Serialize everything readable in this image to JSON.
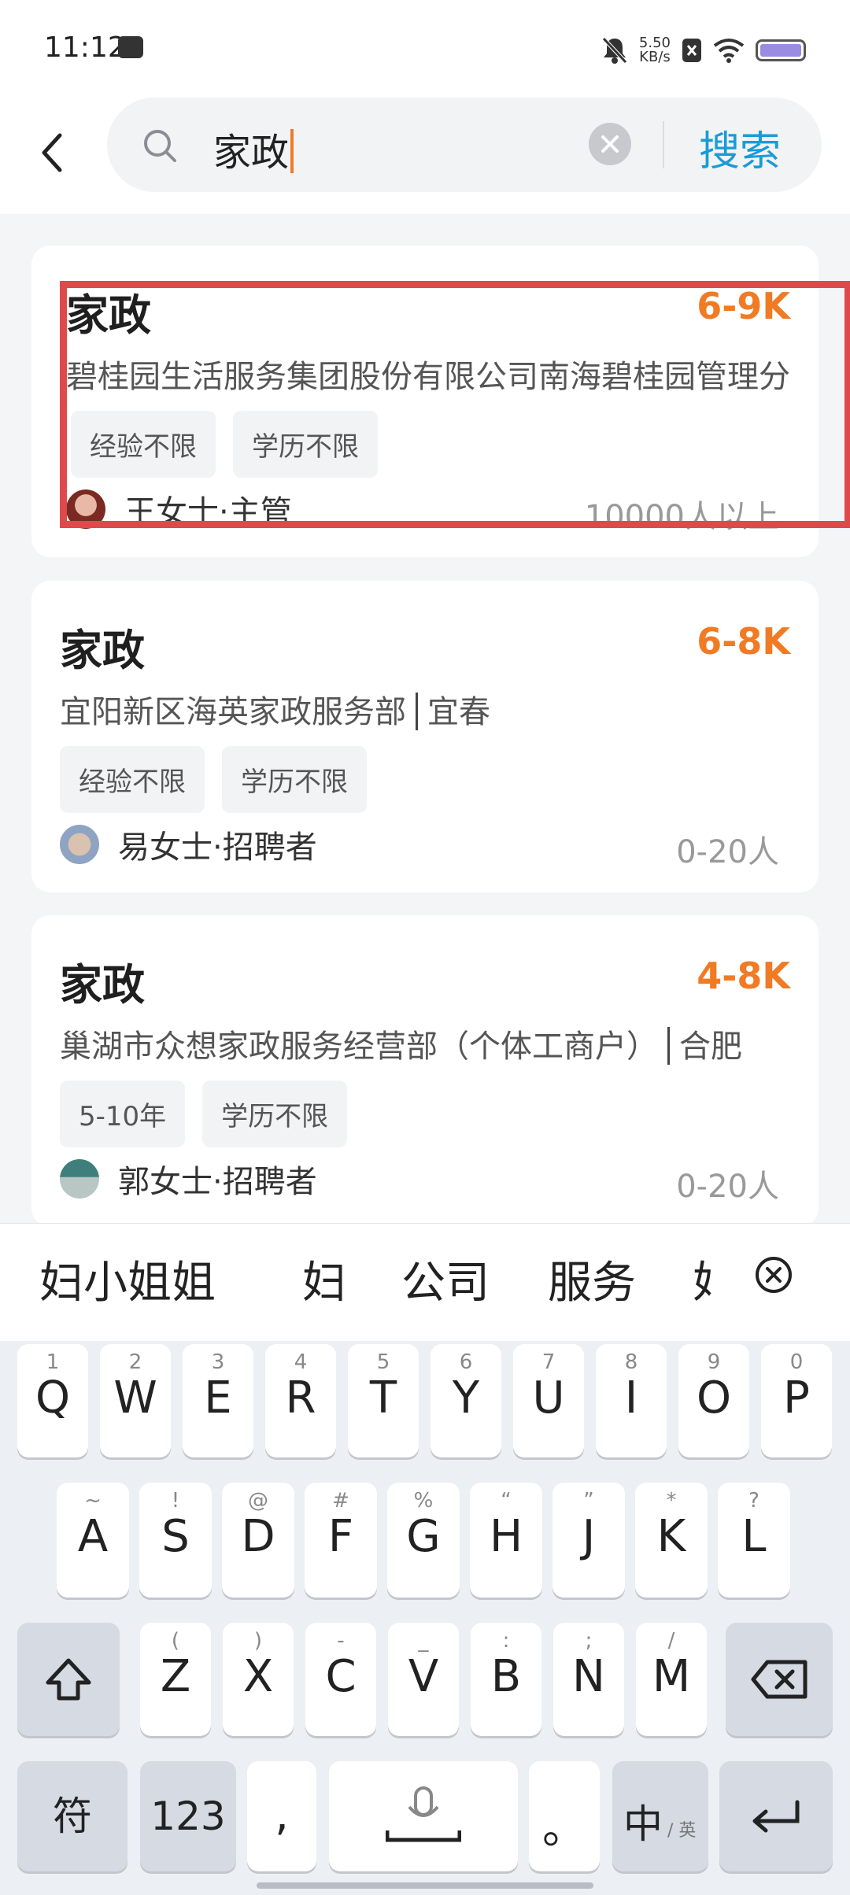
{
  "status_bar": {
    "time": "11:12",
    "net_speed_value": "5.50",
    "net_speed_unit": "KB/s"
  },
  "search": {
    "query": "家政",
    "search_button_label": "搜索"
  },
  "jobs": [
    {
      "title": "家政",
      "salary": "6-9K",
      "company": "碧桂园生活服务集团股份有限公司南海碧桂园管理分",
      "tags": [
        "经验不限",
        "学历不限"
      ],
      "recruiter": "王女士·主管",
      "company_size": "10000人以上"
    },
    {
      "title": "家政",
      "salary": "6-8K",
      "company": "宜阳新区海英家政服务部",
      "city": "宜春",
      "tags": [
        "经验不限",
        "学历不限"
      ],
      "recruiter": "易女士·招聘者",
      "company_size": "0-20人"
    },
    {
      "title": "家政",
      "salary": "4-8K",
      "company": "巢湖市众想家政服务经营部（个体工商户）",
      "city": "合肥",
      "tags": [
        "5-10年",
        "学历不限"
      ],
      "recruiter": "郭女士·招聘者",
      "company_size": "0-20人"
    }
  ],
  "ime": {
    "candidates": [
      "妇小姐姐",
      "妇",
      "公司",
      "服务",
      "妇"
    ]
  },
  "keyboard": {
    "row1": [
      {
        "hint": "1",
        "key": "Q"
      },
      {
        "hint": "2",
        "key": "W"
      },
      {
        "hint": "3",
        "key": "E"
      },
      {
        "hint": "4",
        "key": "R"
      },
      {
        "hint": "5",
        "key": "T"
      },
      {
        "hint": "6",
        "key": "Y"
      },
      {
        "hint": "7",
        "key": "U"
      },
      {
        "hint": "8",
        "key": "I"
      },
      {
        "hint": "9",
        "key": "O"
      },
      {
        "hint": "0",
        "key": "P"
      }
    ],
    "row2": [
      {
        "hint": "~",
        "key": "A"
      },
      {
        "hint": "!",
        "key": "S"
      },
      {
        "hint": "@",
        "key": "D"
      },
      {
        "hint": "#",
        "key": "F"
      },
      {
        "hint": "%",
        "key": "G"
      },
      {
        "hint": "“",
        "key": "H"
      },
      {
        "hint": "”",
        "key": "J"
      },
      {
        "hint": "*",
        "key": "K"
      },
      {
        "hint": "?",
        "key": "L"
      }
    ],
    "row3": [
      {
        "hint": "(",
        "key": "Z"
      },
      {
        "hint": ")",
        "key": "X"
      },
      {
        "hint": "-",
        "key": "C"
      },
      {
        "hint": "_",
        "key": "V"
      },
      {
        "hint": ":",
        "key": "B"
      },
      {
        "hint": ";",
        "key": "N"
      },
      {
        "hint": "/",
        "key": "M"
      }
    ],
    "symbols_label": "符",
    "numbers_label": "123",
    "comma_label": ",",
    "period_label": "。",
    "lang_main": "中",
    "lang_sub": "/ 英"
  }
}
